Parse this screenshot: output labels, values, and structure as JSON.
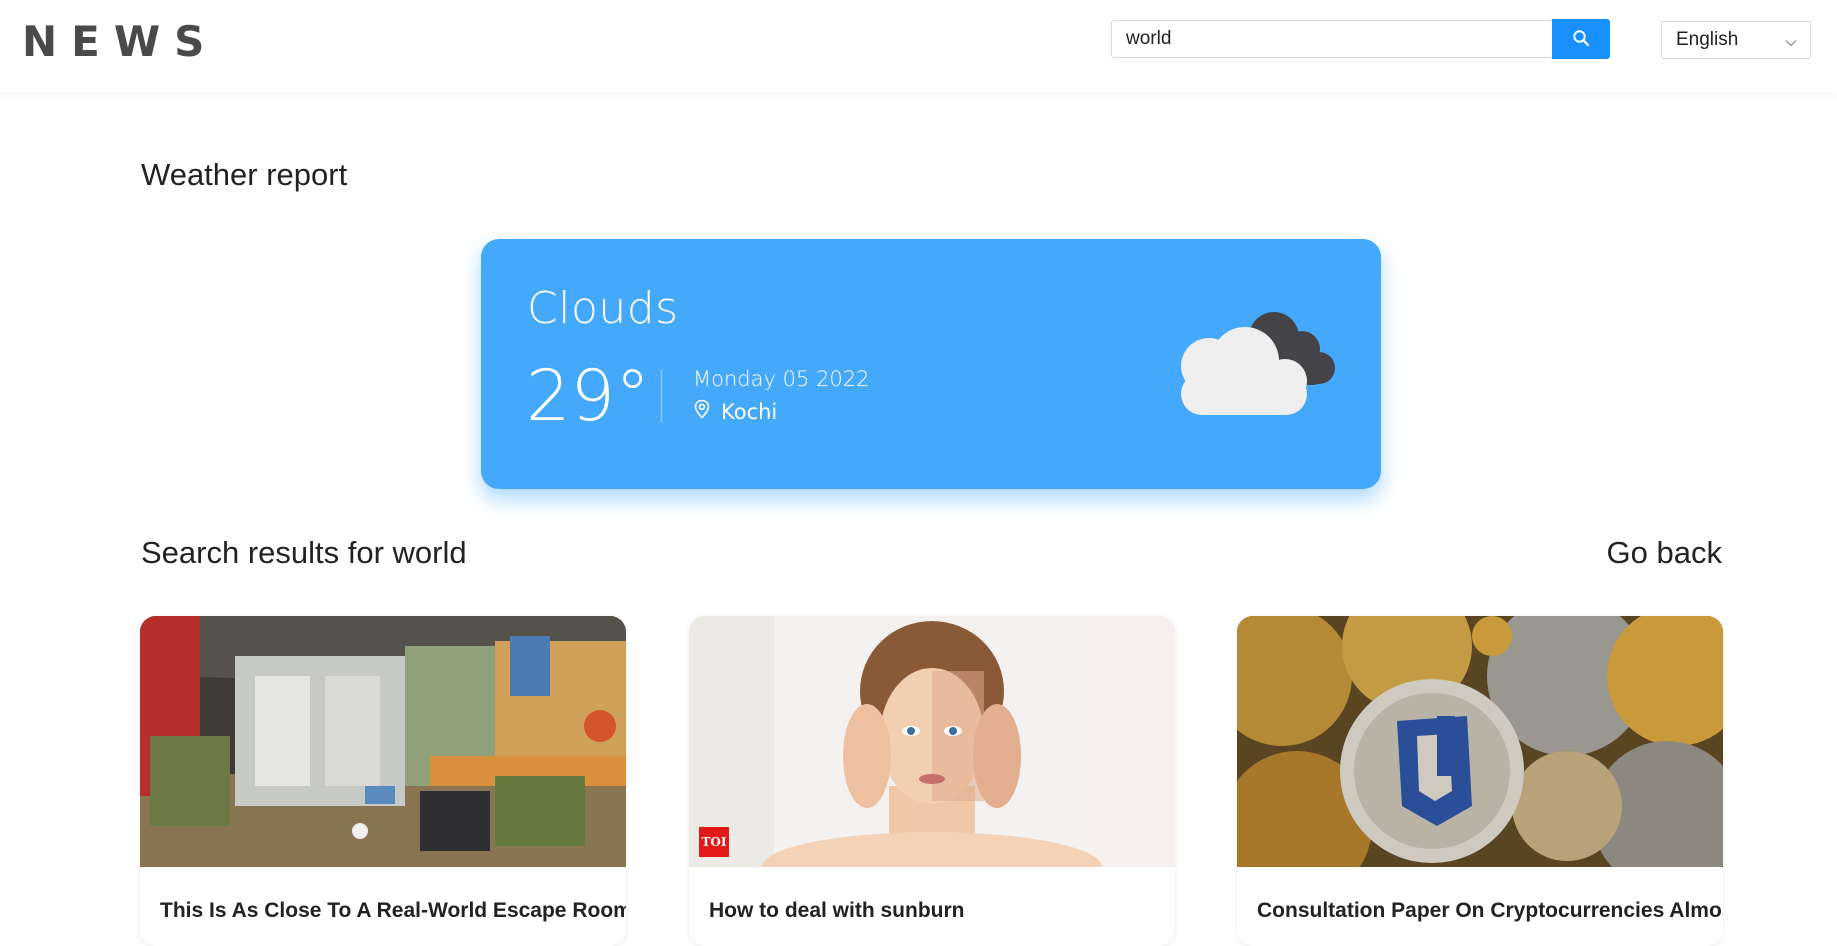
{
  "header": {
    "logo": "NEWS",
    "search": {
      "value": "world",
      "button_icon": "search-icon"
    },
    "language": {
      "selected": "English",
      "icon": "chevron-down-icon"
    }
  },
  "weather": {
    "heading": "Weather report",
    "condition": "Clouds",
    "temperature": "29°",
    "date": "Monday 05 2022",
    "location": "Kochi",
    "location_icon": "location-pin-icon",
    "weather_icon": "cloud-icon",
    "card_color": "#45a9fb"
  },
  "results": {
    "heading_prefix": "Search results for ",
    "query": "world",
    "go_back": "Go back"
  },
  "articles": [
    {
      "title": "This Is As Close To A Real-World Escape Room",
      "image": "escape-room-image"
    },
    {
      "title": "How to deal with sunburn",
      "image": "sunburn-face-image",
      "badge": "TOI"
    },
    {
      "title": "Consultation Paper On Cryptocurrencies Almost",
      "image": "cryptocurrency-coins-image"
    }
  ],
  "colors": {
    "accent": "#1890ff",
    "logo": "#4a4a4a"
  }
}
